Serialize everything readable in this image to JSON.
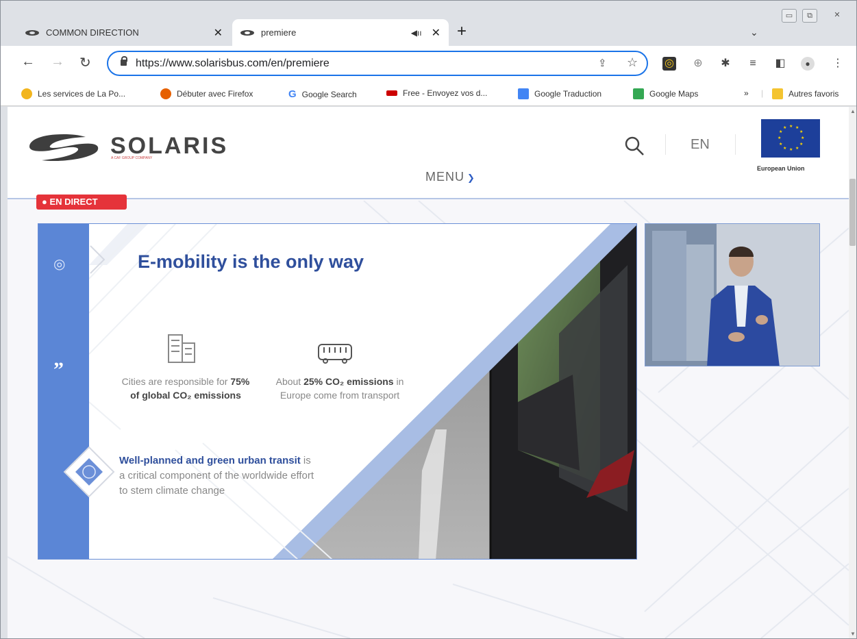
{
  "tabs": [
    {
      "title": "COMMON DIRECTION",
      "active": false
    },
    {
      "title": "premiere",
      "active": true
    }
  ],
  "address_bar": {
    "url": "https://www.solarisbus.com/en/premiere"
  },
  "bookmarks": [
    {
      "label": "Les services de La Po...",
      "color": "#f2b51d"
    },
    {
      "label": "Débuter avec Firefox",
      "color": "#e66000"
    },
    {
      "label": "Google Search",
      "color": "#4285f4"
    },
    {
      "label": "Free - Envoyez vos d...",
      "color": "#cc0000"
    },
    {
      "label": "Google Traduction",
      "color": "#4285f4"
    },
    {
      "label": "Google Maps",
      "color": "#34a853"
    },
    {
      "label": "Autres favoris",
      "color": "#f4c430"
    }
  ],
  "site": {
    "brand": "SOLARIS",
    "brand_sub": "A CAF GROUP COMPANY",
    "lang": "EN",
    "menu": "MENU",
    "eu_label": "European Union"
  },
  "live_badge": "● EN DIRECT",
  "slide": {
    "title": "E-mobility is the only way",
    "stat1": {
      "pre": "Cities are responsible for ",
      "bold": "75% of global CO₂ emissions",
      "post": ""
    },
    "stat2": {
      "pre": "About ",
      "bold": "25% CO₂ emissions",
      "post": " in Europe come from transport"
    },
    "transit": {
      "bold": "Well-planned and green urban transit",
      "rest": " is a critical component of the worldwide effort to stem climate change"
    }
  },
  "colors": {
    "accent": "#1a73e8",
    "slide_bar": "#5b86d6",
    "title": "#2f4f9c",
    "live": "#e5333a"
  }
}
